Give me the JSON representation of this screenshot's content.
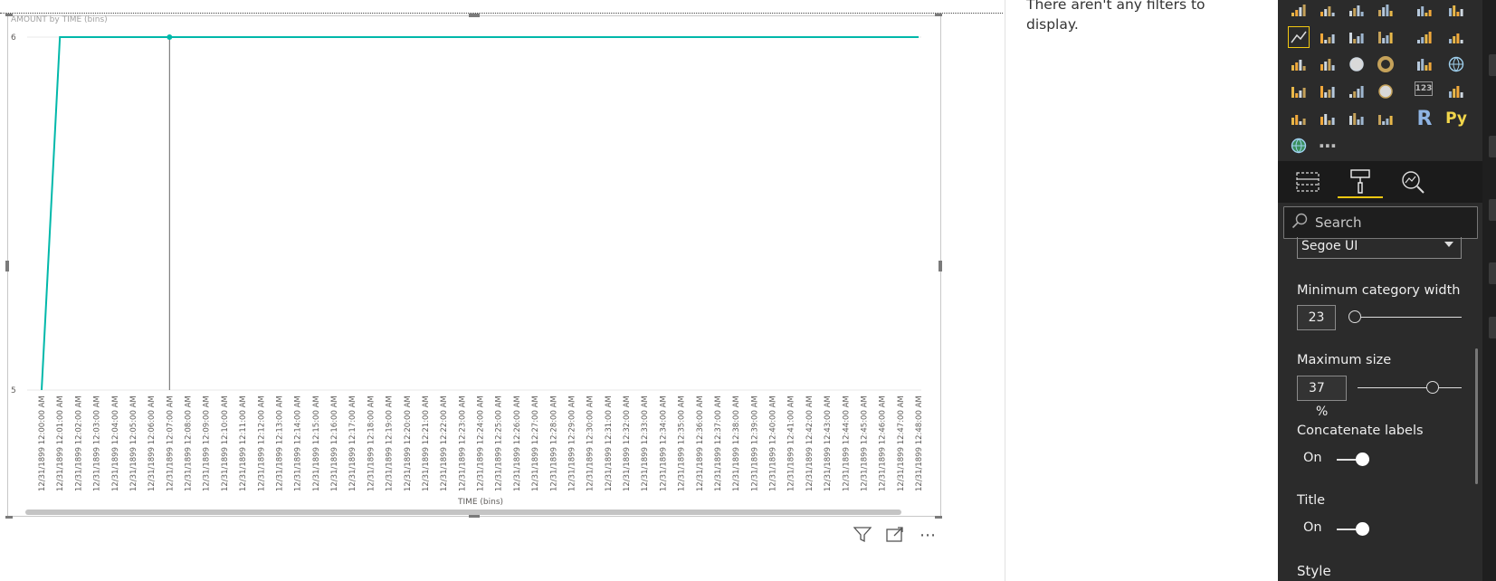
{
  "filters_message": "There aren't any filters to display.",
  "chart_data": {
    "type": "line",
    "title": "AMOUNT by TIME (bins)",
    "xlabel": "TIME (bins)",
    "ylabel": "",
    "ylim": [
      5,
      6
    ],
    "y_ticks": [
      "6",
      "5"
    ],
    "categories": [
      "12/31/1899 12:00:00 AM",
      "12/31/1899 12:01:00 AM",
      "12/31/1899 12:02:00 AM",
      "12/31/1899 12:03:00 AM",
      "12/31/1899 12:04:00 AM",
      "12/31/1899 12:05:00 AM",
      "12/31/1899 12:06:00 AM",
      "12/31/1899 12:07:00 AM",
      "12/31/1899 12:08:00 AM",
      "12/31/1899 12:09:00 AM",
      "12/31/1899 12:10:00 AM",
      "12/31/1899 12:11:00 AM",
      "12/31/1899 12:12:00 AM",
      "12/31/1899 12:13:00 AM",
      "12/31/1899 12:14:00 AM",
      "12/31/1899 12:15:00 AM",
      "12/31/1899 12:16:00 AM",
      "12/31/1899 12:17:00 AM",
      "12/31/1899 12:18:00 AM",
      "12/31/1899 12:19:00 AM",
      "12/31/1899 12:20:00 AM",
      "12/31/1899 12:21:00 AM",
      "12/31/1899 12:22:00 AM",
      "12/31/1899 12:23:00 AM",
      "12/31/1899 12:24:00 AM",
      "12/31/1899 12:25:00 AM",
      "12/31/1899 12:26:00 AM",
      "12/31/1899 12:27:00 AM",
      "12/31/1899 12:28:00 AM",
      "12/31/1899 12:29:00 AM",
      "12/31/1899 12:30:00 AM",
      "12/31/1899 12:31:00 AM",
      "12/31/1899 12:32:00 AM",
      "12/31/1899 12:33:00 AM",
      "12/31/1899 12:34:00 AM",
      "12/31/1899 12:35:00 AM",
      "12/31/1899 12:36:00 AM",
      "12/31/1899 12:37:00 AM",
      "12/31/1899 12:38:00 AM",
      "12/31/1899 12:39:00 AM",
      "12/31/1899 12:40:00 AM",
      "12/31/1899 12:41:00 AM",
      "12/31/1899 12:42:00 AM",
      "12/31/1899 12:43:00 AM",
      "12/31/1899 12:44:00 AM",
      "12/31/1899 12:45:00 AM",
      "12/31/1899 12:46:00 AM",
      "12/31/1899 12:47:00 AM",
      "12/31/1899 12:48:00 AM"
    ],
    "series": [
      {
        "values": [
          5,
          6,
          6,
          6,
          6,
          6,
          6,
          6,
          6,
          6,
          6,
          6,
          6,
          6,
          6,
          6,
          6,
          6,
          6,
          6,
          6,
          6,
          6,
          6,
          6,
          6,
          6,
          6,
          6,
          6,
          6,
          6,
          6,
          6,
          6,
          6,
          6,
          6,
          6,
          6,
          6,
          6,
          6,
          6,
          6,
          6,
          6,
          6,
          6
        ],
        "color": "#01b8aa"
      }
    ],
    "highlighted_category": "12/31/1899 12:07:00 AM",
    "line_color": "#01b8aa",
    "grid": true
  },
  "visual_header": {
    "filter_icon": "filter-icon",
    "focus_icon": "focus-mode-icon",
    "more_label": "⋯"
  },
  "visualizations": {
    "icons": [
      "stacked-bar-icon",
      "stacked-column-icon",
      "clustered-bar-icon",
      "clustered-column-icon",
      "100-bar-icon",
      "100-column-icon",
      "line-chart-icon",
      "area-chart-icon",
      "stacked-area-icon",
      "line-column-icon",
      "line-clustered-column-icon",
      "ribbon-chart-icon",
      "waterfall-icon",
      "scatter-icon",
      "pie-chart-icon",
      "donut-icon",
      "treemap-icon",
      "map-icon",
      "filled-map-icon",
      "shape-map-icon",
      "funnel-icon",
      "gauge-icon",
      "card-icon",
      "multi-row-card-icon",
      "kpi-icon",
      "slicer-icon",
      "table-icon",
      "matrix-icon",
      "r-visual-icon",
      "python-visual-icon",
      "arcgis-icon",
      "more-visuals-icon"
    ],
    "r_label": "R",
    "py_label": "Py",
    "more_label": "⋯",
    "card_label": "123",
    "selected": "line-chart-icon",
    "accent": "#f2c811"
  },
  "pane_tabs": [
    "fields-tab",
    "format-tab",
    "analytics-tab"
  ],
  "search": {
    "placeholder": "Search"
  },
  "format": {
    "font_family_value": "Segoe UI",
    "min_category_width": {
      "label": "Minimum category width",
      "value": "23"
    },
    "max_size": {
      "label": "Maximum size",
      "value": "37",
      "unit": "%",
      "fraction": 0.37
    },
    "concatenate_labels": {
      "label": "Concatenate labels",
      "state": "On"
    },
    "title": {
      "label": "Title",
      "state": "On"
    },
    "style_label": "Style"
  }
}
